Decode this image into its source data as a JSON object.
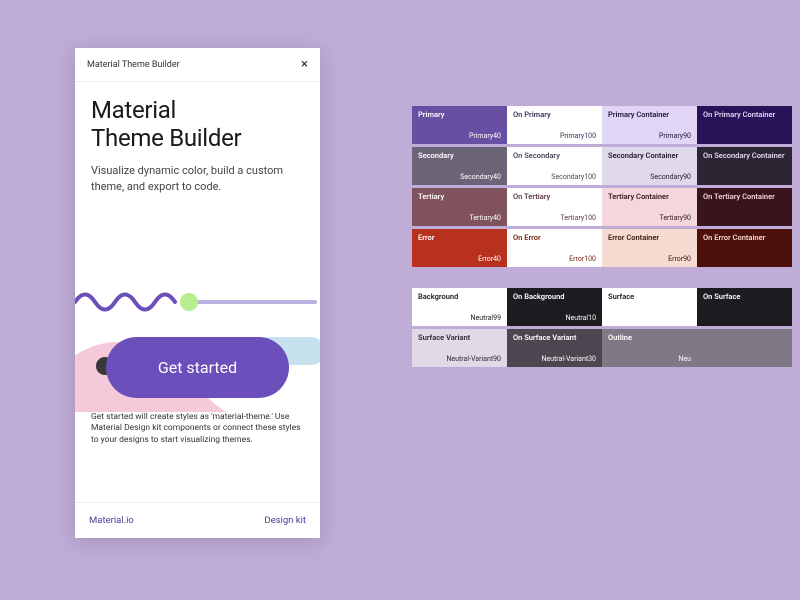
{
  "panel": {
    "header": "Material Theme Builder",
    "title_line1": "Material",
    "title_line2": "Theme Builder",
    "subtitle": "Visualize dynamic color, build a custom theme, and export to code.",
    "cta": "Get started",
    "description": "Get started will create styles as 'material-theme.' Use Material Design kit components or connect these styles to your designs to start visualizing themes.",
    "footer_left": "Material.io",
    "footer_right": "Design kit"
  },
  "decor": {
    "wave": "#6b4fbb",
    "circle": "#b6ed8f",
    "pill": "#c6e2ef",
    "blob": "#f5c9da",
    "dark": "#383838"
  },
  "groups": [
    {
      "rows": [
        [
          {
            "role": "Primary",
            "token": "Primary40",
            "bg": "#6750a4",
            "fg": "#ffffff"
          },
          {
            "role": "On Primary",
            "token": "Primary100",
            "bg": "#ffffff",
            "fg": "#3a3455"
          },
          {
            "role": "Primary Container",
            "token": "Primary90",
            "bg": "#e1d5f5",
            "fg": "#1f1534"
          },
          {
            "role": "On Primary Container",
            "token": "",
            "bg": "#2a1258",
            "fg": "#e1d5f5"
          }
        ],
        [
          {
            "role": "Secondary",
            "token": "Secondary40",
            "bg": "#6b6476",
            "fg": "#ffffff"
          },
          {
            "role": "On Secondary",
            "token": "Secondary100",
            "bg": "#ffffff",
            "fg": "#4d4757"
          },
          {
            "role": "Secondary Container",
            "token": "Secondary90",
            "bg": "#e0d8eb",
            "fg": "#221c2c"
          },
          {
            "role": "On Secondary Container",
            "token": "",
            "bg": "#2c2634",
            "fg": "#e0d8eb"
          }
        ],
        [
          {
            "role": "Tertiary",
            "token": "Tertiary40",
            "bg": "#7f525d",
            "fg": "#ffffff"
          },
          {
            "role": "On Tertiary",
            "token": "Tertiary100",
            "bg": "#ffffff",
            "fg": "#5a3a42"
          },
          {
            "role": "Tertiary Container",
            "token": "Tertiary90",
            "bg": "#f6d6dd",
            "fg": "#30191f"
          },
          {
            "role": "On Tertiary Container",
            "token": "",
            "bg": "#3a141d",
            "fg": "#f6d6dd"
          }
        ],
        [
          {
            "role": "Error",
            "token": "Error40",
            "bg": "#b8301e",
            "fg": "#ffffff"
          },
          {
            "role": "On Error",
            "token": "Error100",
            "bg": "#ffffff",
            "fg": "#7a1f14"
          },
          {
            "role": "Error Container",
            "token": "Error90",
            "bg": "#f7dad1",
            "fg": "#3a1410"
          },
          {
            "role": "On Error Container",
            "token": "",
            "bg": "#4d100b",
            "fg": "#f7dad1"
          }
        ]
      ]
    },
    {
      "rows": [
        [
          {
            "role": "Background",
            "token": "Neutral99",
            "bg": "#ffffff",
            "fg": "#1c1b1e"
          },
          {
            "role": "On Background",
            "token": "Neutral10",
            "bg": "#1e1c20",
            "fg": "#ffffff"
          },
          {
            "role": "Surface",
            "token": "",
            "bg": "#ffffff",
            "fg": "#1c1b1e"
          },
          {
            "role": "On Surface",
            "token": "",
            "bg": "#1e1c20",
            "fg": "#ffffff"
          }
        ],
        [
          {
            "role": "Surface Variant",
            "token": "Neutral-Variant90",
            "bg": "#e0d9e6",
            "fg": "#2e2a33"
          },
          {
            "role": "On Surface Variant",
            "token": "Neutral-Variant30",
            "bg": "#4c4651",
            "fg": "#ffffff"
          },
          {
            "role": "Outline",
            "token": "Neu",
            "bg": "#7f7986",
            "fg": "#ffffff"
          },
          {
            "role": "",
            "token": "",
            "bg": "#7f7986",
            "fg": "#ffffff"
          }
        ]
      ]
    }
  ]
}
